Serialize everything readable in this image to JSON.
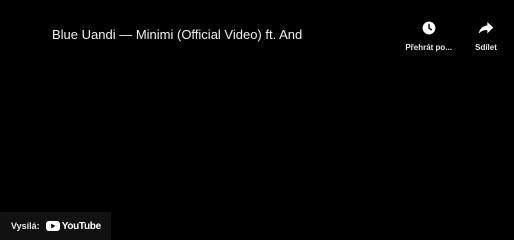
{
  "video": {
    "title": "Blue Uandi — Minimi (Official Video) ft. And"
  },
  "actions": {
    "watch_later_label": "Přehrát po...",
    "share_label": "Sdílet"
  },
  "watermark": {
    "prefix": "Vysílá:",
    "brand": "YouTube"
  },
  "colors": {
    "background": "#000000",
    "text": "#ffffff"
  }
}
